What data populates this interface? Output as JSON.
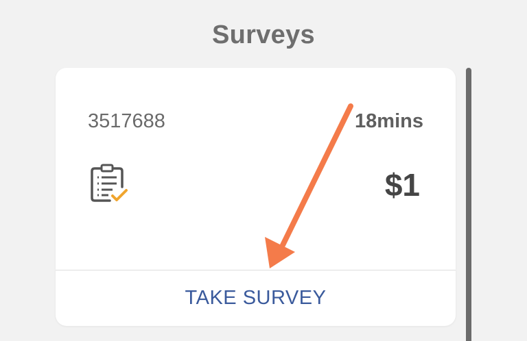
{
  "header": {
    "title": "Surveys"
  },
  "survey_card": {
    "id": "3517688",
    "duration": "18mins",
    "reward": "$1",
    "icon": "clipboard-check-icon",
    "action_label": "TAKE SURVEY"
  },
  "colors": {
    "background": "#f2f2f2",
    "card": "#ffffff",
    "action_text": "#3a5a9c",
    "annotation_arrow": "#f47b4a",
    "check_accent": "#f0a52e"
  }
}
